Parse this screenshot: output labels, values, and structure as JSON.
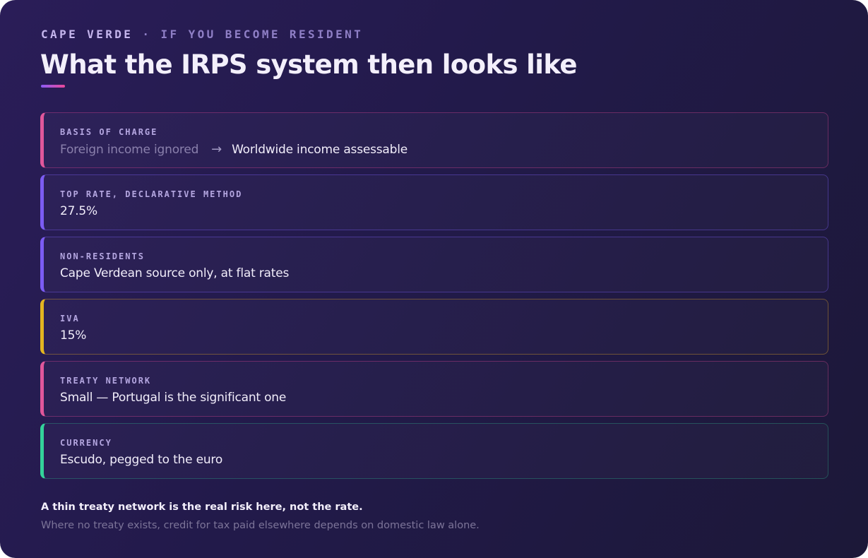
{
  "header": {
    "country": "CAPE VERDE",
    "separator": "·",
    "context": "IF YOU BECOME RESIDENT",
    "title": "What the IRPS system then looks like"
  },
  "rows": [
    {
      "label": "BASIS OF CHARGE",
      "value_before": "Foreign income ignored",
      "arrow": "→",
      "value_after": "Worldwide income assessable",
      "accent": "#e0579b"
    },
    {
      "label": "TOP RATE, DECLARATIVE METHOD",
      "value": "27.5%",
      "accent": "#7c5cf3"
    },
    {
      "label": "NON-RESIDENTS",
      "value": "Cape Verdean source only, at flat rates",
      "accent": "#7c5cf3"
    },
    {
      "label": "IVA",
      "value": "15%",
      "accent": "#e3b521"
    },
    {
      "label": "TREATY NETWORK",
      "value": "Small — Portugal is the significant one",
      "accent": "#e0579b"
    },
    {
      "label": "CURRENCY",
      "value": "Escudo, pegged to the euro",
      "accent": "#34d39a"
    }
  ],
  "footer": {
    "main": "A thin treaty network is the real risk here, not the rate.",
    "sub": "Where no treaty exists, credit for tax paid elsewhere depends on domestic law alone."
  },
  "colors": {
    "background": "#241b4e",
    "accent_pink": "#e0579b",
    "accent_purple": "#7c5cf3",
    "accent_amber": "#e3b521",
    "accent_green": "#34d39a"
  }
}
